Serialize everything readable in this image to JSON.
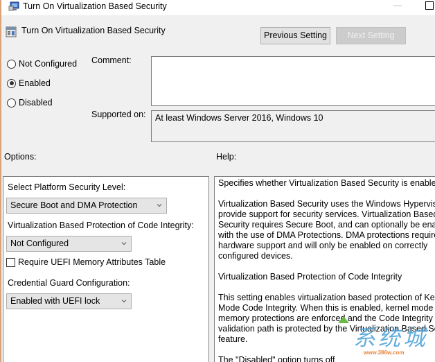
{
  "window": {
    "title": "Turn On Virtualization Based Security",
    "icon": "group-policy-window-icon"
  },
  "header": {
    "policy_title": "Turn On Virtualization Based Security",
    "policy_icon": "policy-setting-icon",
    "previous_label": "Previous Setting",
    "next_label": "Next Setting",
    "next_enabled": false
  },
  "state": {
    "options": [
      {
        "label": "Not Configured",
        "checked": false
      },
      {
        "label": "Enabled",
        "checked": true
      },
      {
        "label": "Disabled",
        "checked": false
      }
    ]
  },
  "comment": {
    "label": "Comment:",
    "value": ""
  },
  "supported": {
    "label": "Supported on:",
    "value": "At least Windows Server 2016, Windows 10"
  },
  "options_panel": {
    "heading": "Options:",
    "platform_label": "Select Platform Security Level:",
    "platform_value": "Secure Boot and DMA Protection",
    "code_integrity_label": "Virtualization Based Protection of Code Integrity:",
    "code_integrity_value": "Not Configured",
    "uefi_checkbox_label": "Require UEFI Memory Attributes Table",
    "uefi_checked": false,
    "credential_guard_label": "Credential Guard Configuration:",
    "credential_guard_value": "Enabled with UEFI lock"
  },
  "help_panel": {
    "heading": "Help:",
    "paragraphs": [
      "Specifies whether Virtualization Based Security is enabled.",
      "Virtualization Based Security uses the Windows Hypervisor t\nprovide support for security services. Virtualization Based\nSecurity requires Secure Boot, and can optionally be enable\nwith the use of DMA Protections. DMA protections require\nhardware support and will only be enabled on correctly\nconfigured devices.",
      "Virtualization Based Protection of Code Integrity",
      "This setting enables virtualization based protection of Kerne\nMode Code Integrity. When this is enabled, kernel mode\nmemory protections are enforced and the Code Integrity\nvalidation path is protected by the Virtualization Based Secu\nfeature.",
      "The \"Disabled\" option turns off"
    ]
  },
  "watermark": {
    "text": "系统城",
    "url": "www.386w.com"
  }
}
